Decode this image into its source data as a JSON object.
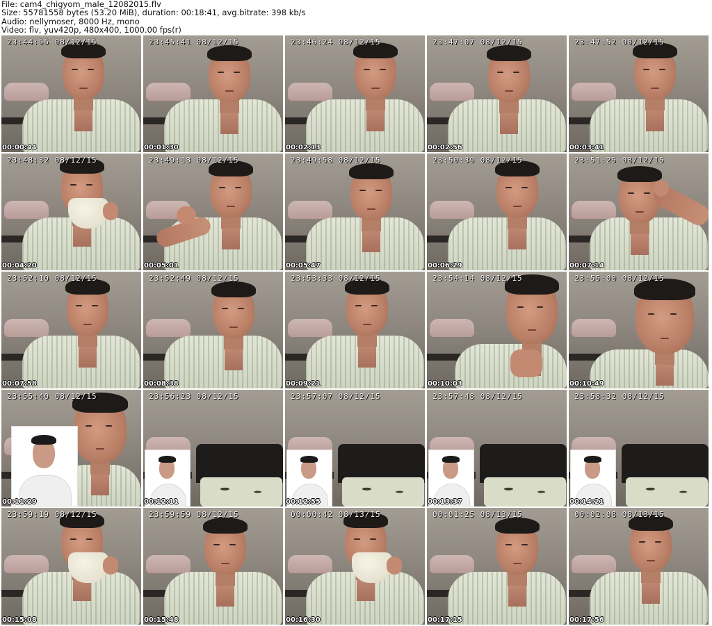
{
  "header": {
    "file_line": "File: cam4_chigyom_male_12082015.flv",
    "size_line": "Size: 55781558 bytes (53.20 MiB), duration: 00:18:41, avg.bitrate: 398 kb/s",
    "audio_line": "Audio: nellymoser, 8000 Hz, mono",
    "video_line": "Video: flv, yuv420p, 480x400, 1000.00 fps(r)"
  },
  "thumbnails": [
    {
      "stamp": "23:44:55 08/12/15",
      "time": "00:00:44",
      "scene": "face"
    },
    {
      "stamp": "23:45:41 08/12/15",
      "time": "00:01:30",
      "scene": "face"
    },
    {
      "stamp": "23:46:24 08/12/15",
      "time": "00:02:13",
      "scene": "face"
    },
    {
      "stamp": "23:47:07 08/12/15",
      "time": "00:02:56",
      "scene": "face"
    },
    {
      "stamp": "23:47:52 08/12/15",
      "time": "00:03:41",
      "scene": "face"
    },
    {
      "stamp": "23:48:32 08/12/15",
      "time": "00:04:20",
      "scene": "cup"
    },
    {
      "stamp": "23:49:13 08/12/15",
      "time": "00:05:01",
      "scene": "arm"
    },
    {
      "stamp": "23:49:58 08/12/15",
      "time": "00:05:47",
      "scene": "face"
    },
    {
      "stamp": "23:50:39 08/12/15",
      "time": "00:06:29",
      "scene": "face"
    },
    {
      "stamp": "23:51:25 08/12/15",
      "time": "00:07:14",
      "scene": "arm-up"
    },
    {
      "stamp": "23:52:10 08/12/15",
      "time": "00:07:58",
      "scene": "face"
    },
    {
      "stamp": "23:52:49 08/12/15",
      "time": "00:08:38",
      "scene": "face"
    },
    {
      "stamp": "23:53:33 08/12/15",
      "time": "00:09:21",
      "scene": "face"
    },
    {
      "stamp": "23:54:14 08/12/15",
      "time": "00:10:03",
      "scene": "closeup-hand"
    },
    {
      "stamp": "23:55:00 08/12/15",
      "time": "00:10:49",
      "scene": "closeup"
    },
    {
      "stamp": "23:55:40 08/12/15",
      "time": "00:11:29",
      "scene": "photo-face"
    },
    {
      "stamp": "23:56:23 08/12/15",
      "time": "00:12:11",
      "scene": "photo-couch"
    },
    {
      "stamp": "23:57:07 08/12/15",
      "time": "00:12:55",
      "scene": "photo-couch"
    },
    {
      "stamp": "23:57:48 08/12/15",
      "time": "00:13:37",
      "scene": "photo-couch"
    },
    {
      "stamp": "23:58:32 08/12/15",
      "time": "00:14:21",
      "scene": "photo-couch"
    },
    {
      "stamp": "23:59:19 08/12/15",
      "time": "00:15:08",
      "scene": "cup"
    },
    {
      "stamp": "23:59:59 08/12/15",
      "time": "00:15:48",
      "scene": "face"
    },
    {
      "stamp": "00:00:42 08/13/15",
      "time": "00:16:30",
      "scene": "cup"
    },
    {
      "stamp": "00:01:25 08/13/15",
      "time": "00:17:15",
      "scene": "face"
    },
    {
      "stamp": "00:02:08 08/13/15",
      "time": "00:17:56",
      "scene": "face"
    }
  ]
}
